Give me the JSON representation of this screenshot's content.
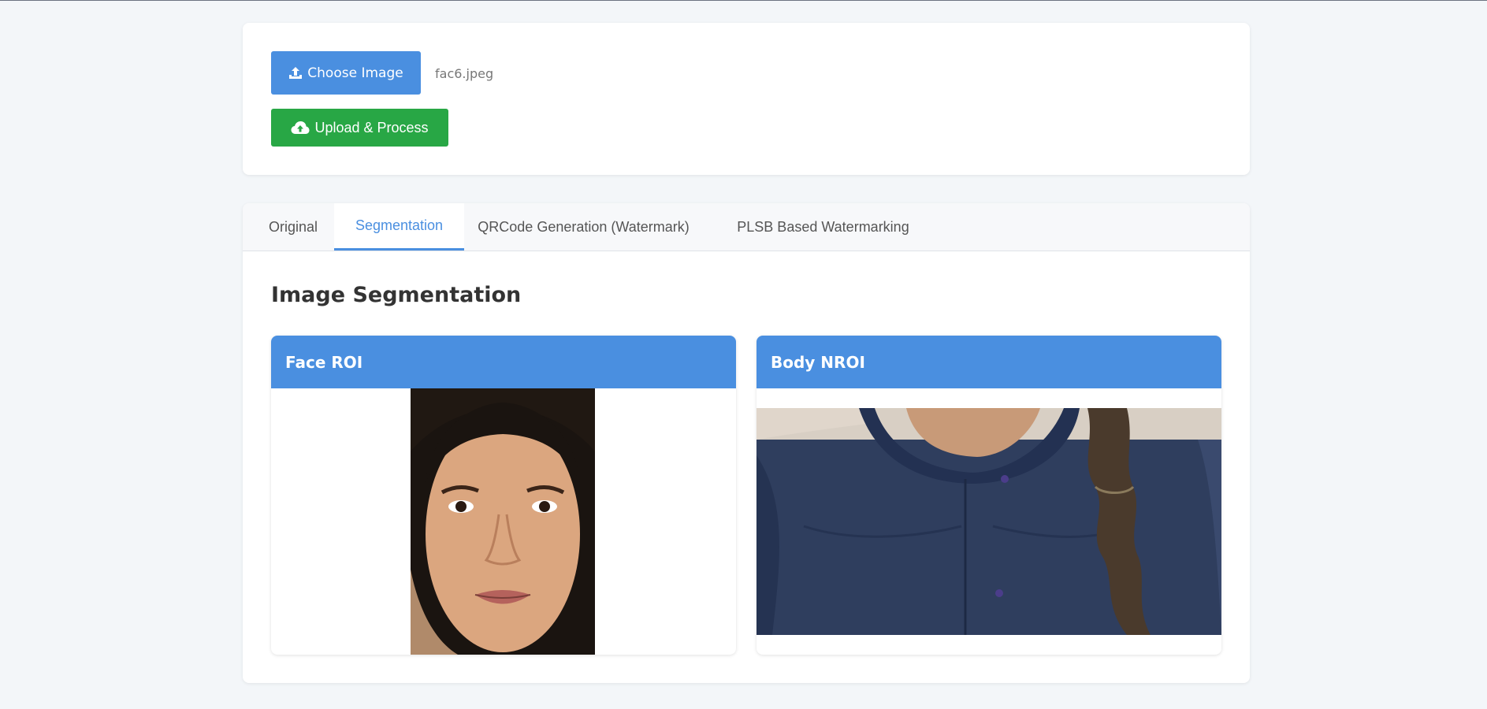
{
  "upload": {
    "choose_label": "Choose Image",
    "file_name": "fac6.jpeg",
    "upload_label": "Upload & Process"
  },
  "tabs": [
    {
      "label": "Original"
    },
    {
      "label": "Segmentation",
      "active": true
    },
    {
      "label": "QRCode Generation (Watermark)"
    },
    {
      "label": "PLSB Based Watermarking"
    }
  ],
  "section": {
    "title": "Image Segmentation",
    "panels": [
      {
        "title": "Face ROI"
      },
      {
        "title": "Body NROI"
      }
    ]
  },
  "colors": {
    "accent": "#4a8fe0",
    "success": "#28a745",
    "background": "#f3f6f9"
  },
  "icons": {
    "choose": "upload-icon",
    "upload": "cloud-upload-icon"
  }
}
